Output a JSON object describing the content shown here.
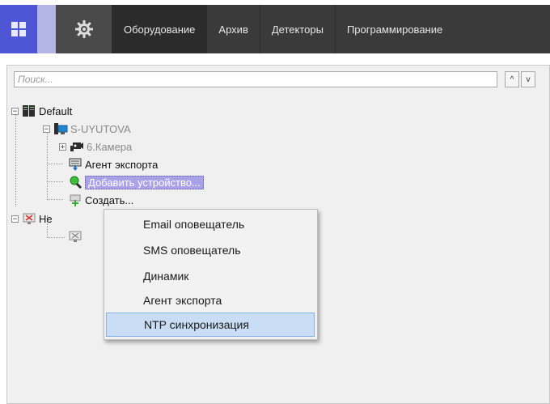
{
  "toolbar": {
    "tabs": [
      {
        "label": "Оборудование",
        "active": true
      },
      {
        "label": "Архив",
        "active": false
      },
      {
        "label": "Детекторы",
        "active": false
      },
      {
        "label": "Программирование",
        "active": false
      }
    ],
    "home_icon": "windows-grid-icon",
    "settings_icon": "gear-icon"
  },
  "search": {
    "placeholder": "Поиск...",
    "up_glyph": "^",
    "down_glyph": "v"
  },
  "tree": {
    "root": {
      "label": "Default",
      "expanded": true
    },
    "server": {
      "label": "S-UYUTOVA",
      "expanded": true
    },
    "camera": {
      "label": "6.Камера"
    },
    "export_agent": {
      "label": "Агент экспорта"
    },
    "add_device": {
      "label": "Добавить устройство..."
    },
    "create": {
      "label": "Создать..."
    },
    "second_server": {
      "label": "Не"
    }
  },
  "context_menu": {
    "items": [
      {
        "label": "Email оповещатель",
        "highlighted": false
      },
      {
        "label": "SMS оповещатель",
        "highlighted": false
      },
      {
        "label": "Динамик",
        "highlighted": false
      },
      {
        "label": "Агент экспорта",
        "highlighted": false
      },
      {
        "label": "NTP синхронизация",
        "highlighted": true
      }
    ]
  },
  "colors": {
    "accent": "#4f56d6",
    "topbar": "#3a3a3a",
    "selection": "#a9a2e6",
    "menu_highlight": "#c9def4"
  }
}
